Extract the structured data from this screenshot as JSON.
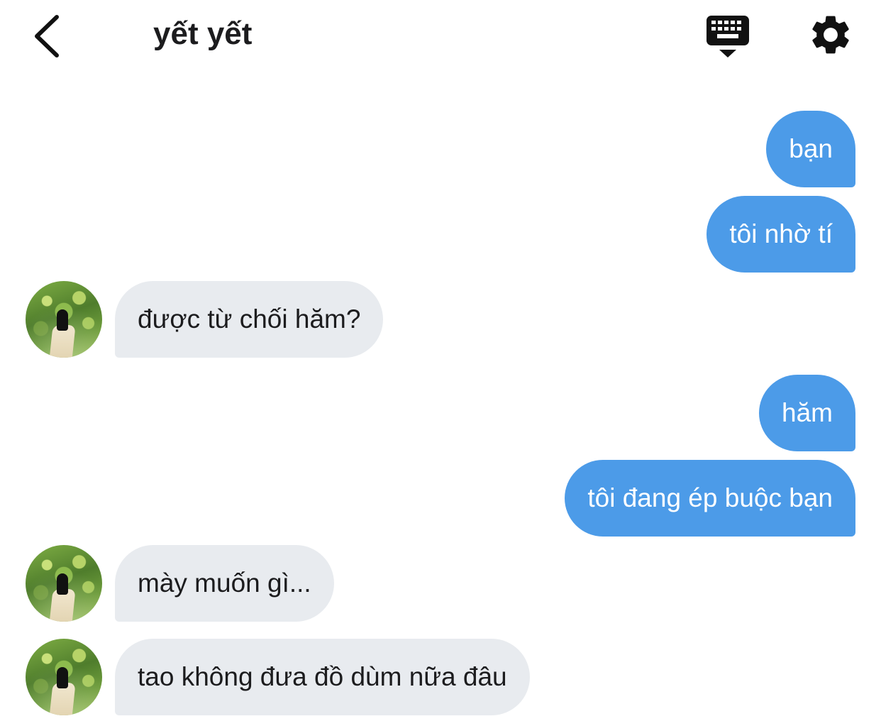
{
  "header": {
    "title": "yết yết",
    "back_icon": "chevron-left-icon",
    "keyboard_icon": "keyboard-dismiss-icon",
    "settings_icon": "gear-icon"
  },
  "colors": {
    "outgoing_bubble": "#4c9be8",
    "incoming_bubble": "#e8ebef",
    "text_dark": "#1c1c1e"
  },
  "messages": [
    {
      "direction": "out",
      "text": "bạn"
    },
    {
      "direction": "out",
      "text": "tôi nhờ tí"
    },
    {
      "direction": "in",
      "text": "được từ chối hăm?"
    },
    {
      "direction": "out",
      "text": "hăm"
    },
    {
      "direction": "out",
      "text": "tôi đang ép buộc bạn"
    },
    {
      "direction": "in",
      "text": "mày muốn gì..."
    },
    {
      "direction": "in",
      "text": "tao không đưa đồ dùm nữa đâu"
    }
  ]
}
